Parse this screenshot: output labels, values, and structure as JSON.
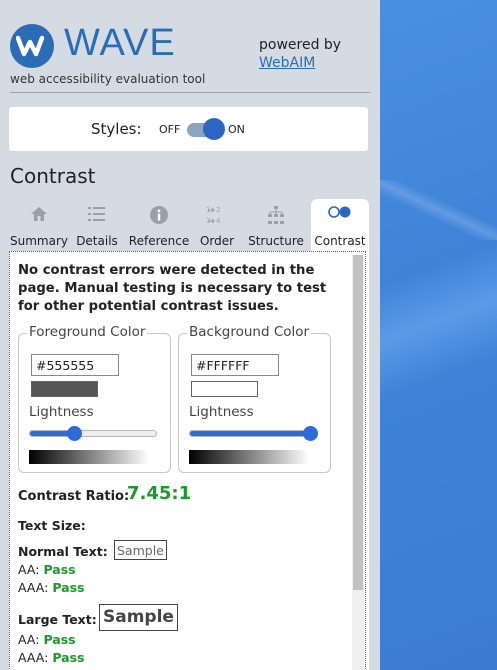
{
  "header": {
    "app_name": "WAVE",
    "tagline": "web accessibility evaluation tool",
    "powered_by": "powered by",
    "powered_link": "WebAIM",
    "brand_color": "#2a6db5"
  },
  "styles_toggle": {
    "label": "Styles:",
    "off": "OFF",
    "on": "ON",
    "state": "on"
  },
  "section_title": "Contrast",
  "tabs": [
    {
      "label": "Summary",
      "icon": "home-icon"
    },
    {
      "label": "Details",
      "icon": "list-icon"
    },
    {
      "label": "Reference",
      "icon": "info-icon"
    },
    {
      "label": "Order",
      "icon": "order-icon"
    },
    {
      "label": "Structure",
      "icon": "structure-icon"
    },
    {
      "label": "Contrast",
      "icon": "contrast-icon",
      "active": true
    }
  ],
  "contrast": {
    "message": "No contrast errors were detected in the page. Manual testing is necessary to test for other potential contrast issues.",
    "foreground": {
      "legend": "Foreground Color",
      "hex": "#555555",
      "lightness_label": "Lightness",
      "lightness": 0.33
    },
    "background": {
      "legend": "Background Color",
      "hex": "#FFFFFF",
      "lightness_label": "Lightness",
      "lightness": 1.0
    },
    "ratio_label": "Contrast Ratio:",
    "ratio_value": "7.45:1",
    "text_size_label": "Text Size:",
    "normal_text_label": "Normal Text:",
    "sample": "Sample",
    "normal_aa_label": "AA:",
    "normal_aa": "Pass",
    "normal_aaa_label": "AAA:",
    "normal_aaa": "Pass",
    "large_text_label": "Large Text:",
    "large_aa_label": "AA:",
    "large_aa": "Pass",
    "large_aaa_label": "AAA:",
    "large_aaa": "Pass",
    "pass_color": "#1d9a2c"
  }
}
